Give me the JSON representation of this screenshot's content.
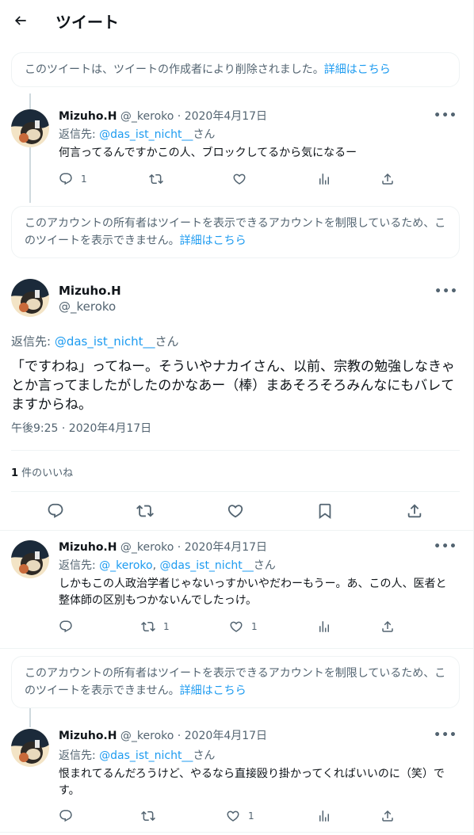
{
  "header": {
    "title": "ツイート"
  },
  "notice_deleted": {
    "text": "このツイートは、ツイートの作成者により削除されました。",
    "link": "詳細はこちら"
  },
  "notice_protected": {
    "text": "このアカウントの所有者はツイートを表示できるアカウントを制限しているため、このツイートを表示できません。",
    "link": "詳細はこちら"
  },
  "reply1": {
    "name": "Mizuho.H",
    "handle": "@_keroko",
    "date": "2020年4月17日",
    "replying_prefix": "返信先: ",
    "replying_to": "@das_ist_nicht__",
    "replying_suffix": "さん",
    "text": "何言ってるんですかこの人、ブロックしてるから気になるー",
    "reply_count": "1",
    "retweet_count": "",
    "like_count": ""
  },
  "main": {
    "name": "Mizuho.H",
    "handle": "@_keroko",
    "replying_prefix": "返信先: ",
    "replying_to": "@das_ist_nicht__",
    "replying_suffix": "さん",
    "text": "「ですわね」ってねー。そういやナカイさん、以前、宗教の勉強しなきゃとか言ってましたがしたのかなあー（棒）まあそろそろみんなにもバレてますからね。",
    "timestamp": "午後9:25 · 2020年4月17日",
    "likes_count": "1",
    "likes_label": " 件のいいね"
  },
  "reply2": {
    "name": "Mizuho.H",
    "handle": "@_keroko",
    "date": "2020年4月17日",
    "replying_prefix": "返信先: ",
    "replying_to_1": "@_keroko",
    "replying_sep": ", ",
    "replying_to_2": "@das_ist_nicht__",
    "replying_suffix": "さん",
    "text": "しかもこの人政治学者じゃないっすかいやだわーもうー。あ、この人、医者と整体師の区別もつかないんでしたっけ。",
    "reply_count": "",
    "retweet_count": "1",
    "like_count": "1"
  },
  "reply3": {
    "name": "Mizuho.H",
    "handle": "@_keroko",
    "date": "2020年4月17日",
    "replying_prefix": "返信先: ",
    "replying_to": "@das_ist_nicht__",
    "replying_suffix": "さん",
    "text": "恨まれてるんだろうけど、やるなら直接殴り掛かってくればいいのに（笑）です。",
    "reply_count": "",
    "retweet_count": "",
    "like_count": "1"
  },
  "separator": " · ",
  "icons": [
    "back-arrow-icon",
    "reply-icon",
    "retweet-icon",
    "like-icon",
    "analytics-icon",
    "share-icon",
    "bookmark-icon",
    "more-icon"
  ],
  "colors": {
    "link": "#1d9bf0",
    "secondary": "#536471",
    "text": "#0f1419",
    "border": "#eff3f4"
  }
}
